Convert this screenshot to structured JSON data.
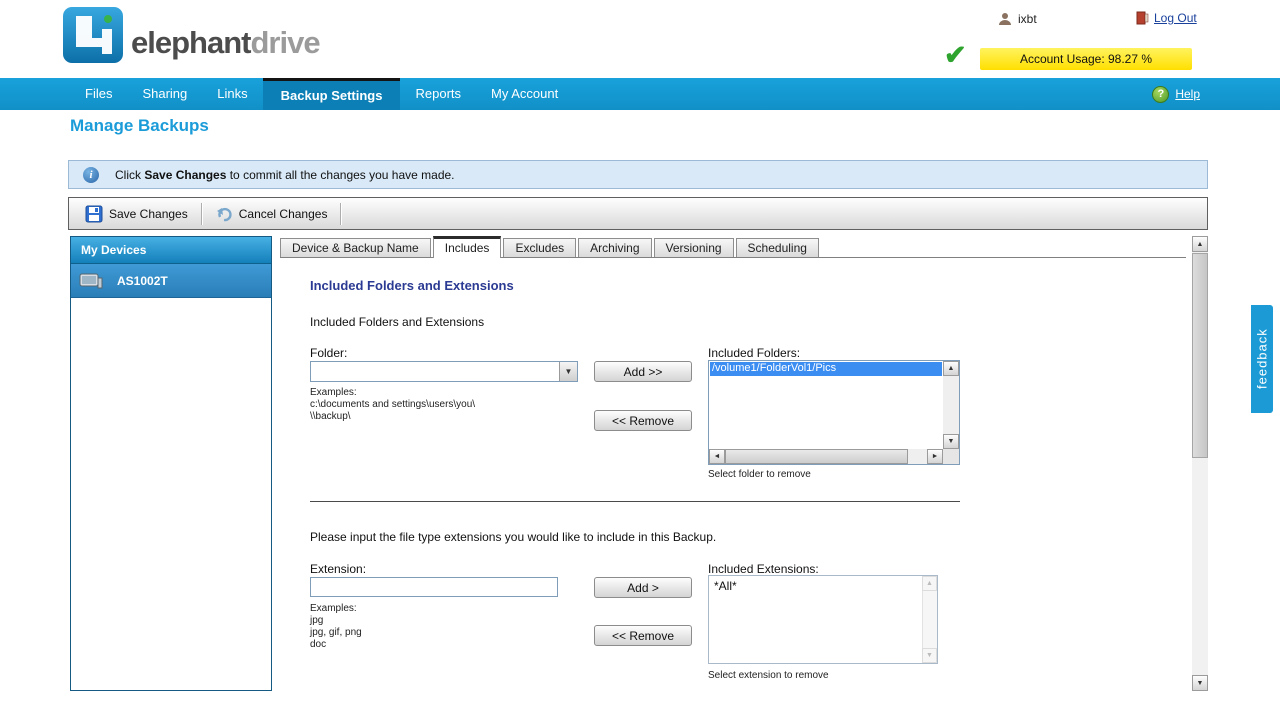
{
  "header": {
    "logo_text_1": "elephant",
    "logo_text_2": "drive",
    "username": "ixbt",
    "logout_label": "Log Out",
    "account_usage": "Account Usage: 98.27 %"
  },
  "nav": {
    "items": [
      {
        "label": "Files"
      },
      {
        "label": "Sharing"
      },
      {
        "label": "Links"
      },
      {
        "label": "Backup Settings"
      },
      {
        "label": "Reports"
      },
      {
        "label": "My Account"
      }
    ],
    "help_label": "Help"
  },
  "page": {
    "title": "Manage Backups",
    "info_message_prefix": "Click ",
    "info_message_bold": "Save Changes",
    "info_message_suffix": " to commit all the changes you have made."
  },
  "toolbar": {
    "save_label": "Save Changes",
    "cancel_label": "Cancel Changes"
  },
  "sidebar": {
    "title": "My Devices",
    "devices": [
      {
        "name": "AS1002T"
      }
    ]
  },
  "tabs": [
    {
      "label": "Device & Backup Name"
    },
    {
      "label": "Includes"
    },
    {
      "label": "Excludes"
    },
    {
      "label": "Archiving"
    },
    {
      "label": "Versioning"
    },
    {
      "label": "Scheduling"
    }
  ],
  "includes": {
    "heading": "Included Folders and Extensions",
    "subheading": "Included Folders and Extensions",
    "folder_label": "Folder:",
    "folder_examples_title": "Examples:",
    "folder_examples": [
      "c:\\documents and settings\\users\\you\\",
      "\\\\backup\\"
    ],
    "add_folder_label": "Add >>",
    "remove_folder_label": "<< Remove",
    "included_folders_label": "Included Folders:",
    "included_folders": [
      "/volume1/FolderVol1/Pics"
    ],
    "select_folder_hint": "Select folder to remove",
    "extensions_instruction": "Please input the file type extensions you would like to include in this Backup.",
    "extension_label": "Extension:",
    "extension_examples_title": "Examples:",
    "extension_examples": [
      "jpg",
      "jpg, gif, png",
      "doc"
    ],
    "add_extension_label": "Add >",
    "remove_extension_label": "<< Remove",
    "included_extensions_label": "Included Extensions:",
    "included_extensions": [
      "*All*"
    ],
    "select_extension_hint": "Select extension to remove"
  },
  "feedback_label": "feedback",
  "icons": {
    "checkmark": "✔",
    "help": "?",
    "info": "i",
    "dropdown_arrow": "▼",
    "scroll_up": "▲",
    "scroll_down": "▼",
    "scroll_left": "◄",
    "scroll_right": "►"
  }
}
